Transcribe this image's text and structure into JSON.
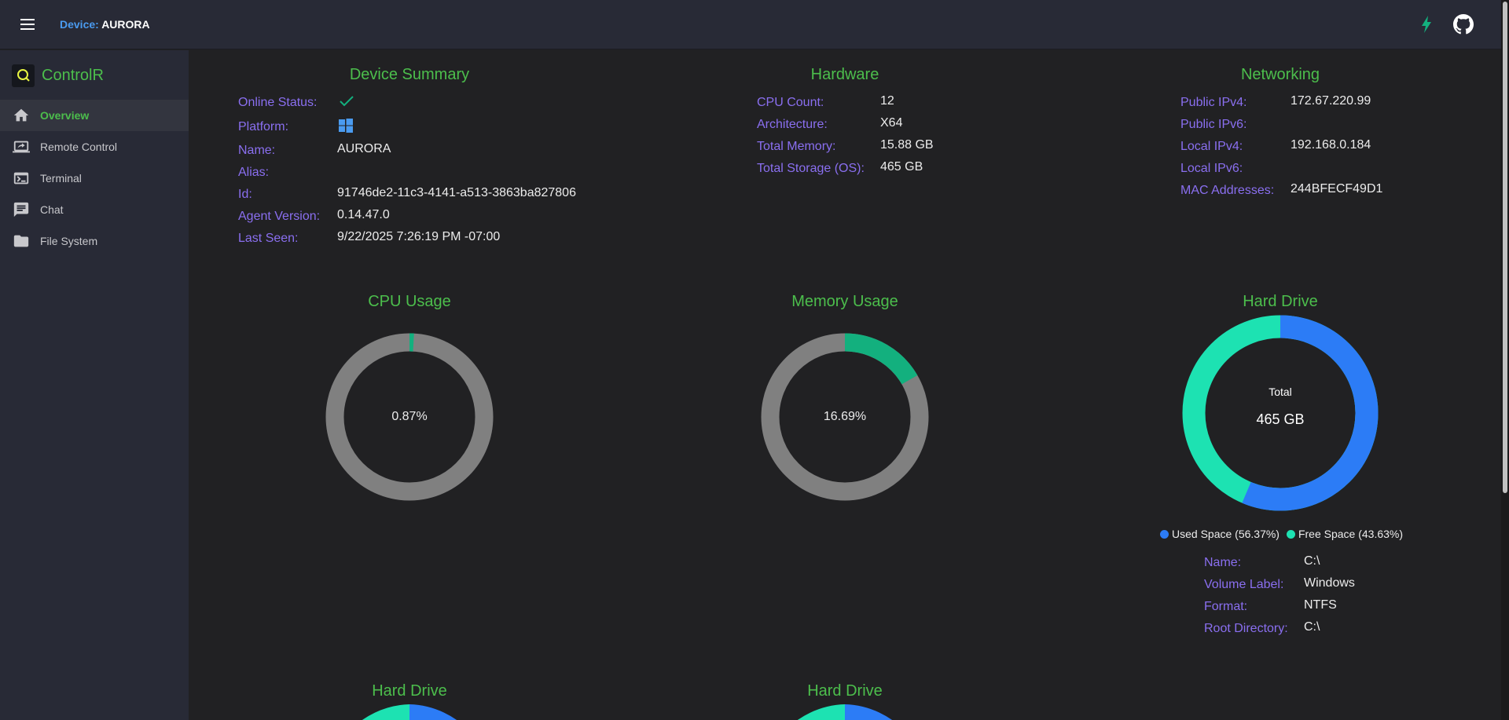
{
  "header": {
    "device_key": "Device:",
    "device_value": "AURORA"
  },
  "sidebar": {
    "brand": "ControlR",
    "items": [
      {
        "label": "Overview"
      },
      {
        "label": "Remote Control"
      },
      {
        "label": "Terminal"
      },
      {
        "label": "Chat"
      },
      {
        "label": "File System"
      }
    ]
  },
  "summary": {
    "title": "Device Summary",
    "online_status": "Online Status:",
    "platform": "Platform:",
    "name_k": "Name:",
    "name_v": "AURORA",
    "alias_k": "Alias:",
    "alias_v": "",
    "id_k": "Id:",
    "id_v": "91746de2-11c3-4141-a513-3863ba827806",
    "agent_k": "Agent Version:",
    "agent_v": "0.14.47.0",
    "seen_k": "Last Seen:",
    "seen_v": "9/22/2025 7:26:19 PM -07:00"
  },
  "hardware": {
    "title": "Hardware",
    "cpu_k": "CPU Count:",
    "cpu_v": "12",
    "arch_k": "Architecture:",
    "arch_v": "X64",
    "mem_k": "Total Memory:",
    "mem_v": "15.88 GB",
    "stor_k": "Total Storage (OS):",
    "stor_v": "465 GB"
  },
  "networking": {
    "title": "Networking",
    "pub4_k": "Public IPv4:",
    "pub4_v": "172.67.220.99",
    "pub6_k": "Public IPv6:",
    "pub6_v": "",
    "loc4_k": "Local IPv4:",
    "loc4_v": "192.168.0.184",
    "loc6_k": "Local IPv6:",
    "loc6_v": "",
    "mac_k": "MAC Addresses:",
    "mac_v": "244BFECF49D1"
  },
  "cpu_usage": {
    "title": "CPU Usage",
    "label": "0.87%",
    "percent": 0.87
  },
  "memory_usage": {
    "title": "Memory Usage",
    "label": "16.69%",
    "percent": 16.69
  },
  "hard_drive": {
    "title": "Hard Drive",
    "center_top": "Total",
    "center_value": "465 GB",
    "used_percent": 56.37,
    "used_label": "Used Space (56.37%)",
    "free_label": "Free Space (43.63%)",
    "name_k": "Name:",
    "name_v": "C:\\",
    "vol_k": "Volume Label:",
    "vol_v": "Windows",
    "fmt_k": "Format:",
    "fmt_v": "NTFS",
    "root_k": "Root Directory:",
    "root_v": "C:\\"
  },
  "more_drives": [
    {
      "title": "Hard Drive"
    },
    {
      "title": "Hard Drive"
    }
  ],
  "colors": {
    "accent_green": "#4cbe4c",
    "label_purple": "#8a6ff0",
    "usage_green": "#13b07e",
    "track_gray": "#808080",
    "used_blue": "#2c7cf6",
    "free_teal": "#1de2b2"
  }
}
